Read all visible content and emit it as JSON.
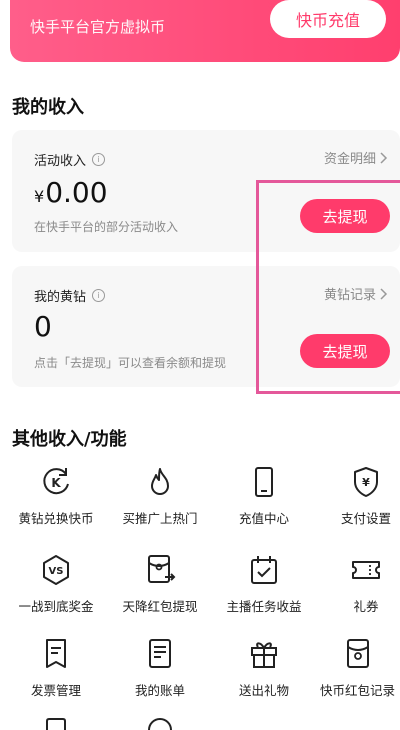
{
  "banner": {
    "text": "快手平台官方虚拟币",
    "recharge_label": "快币充值"
  },
  "my_income": {
    "title": "我的收入",
    "activity": {
      "title": "活动收入",
      "link": "资金明细",
      "currency": "¥",
      "amount": "0.00",
      "desc": "在快手平台的部分活动收入",
      "button": "去提现"
    },
    "diamond": {
      "title": "我的黄钻",
      "link": "黄钻记录",
      "amount": "0",
      "desc": "点击「去提现」可以查看余额和提现",
      "button": "去提现"
    }
  },
  "other": {
    "title": "其他收入/功能",
    "items": [
      {
        "label": "黄钻兑换快币",
        "icon": "exchange-k-icon"
      },
      {
        "label": "买推广上热门",
        "icon": "flame-icon"
      },
      {
        "label": "充值中心",
        "icon": "phone-icon"
      },
      {
        "label": "支付设置",
        "icon": "yuan-shield-icon"
      },
      {
        "label": "一战到底奖金",
        "icon": "vs-icon"
      },
      {
        "label": "天降红包提现",
        "icon": "red-packet-withdraw-icon"
      },
      {
        "label": "主播任务收益",
        "icon": "calendar-check-icon"
      },
      {
        "label": "礼券",
        "icon": "ticket-icon"
      },
      {
        "label": "发票管理",
        "icon": "invoice-icon"
      },
      {
        "label": "我的账单",
        "icon": "bill-icon"
      },
      {
        "label": "送出礼物",
        "icon": "gift-icon"
      },
      {
        "label": "快币红包记录",
        "icon": "coin-red-packet-icon"
      }
    ]
  }
}
